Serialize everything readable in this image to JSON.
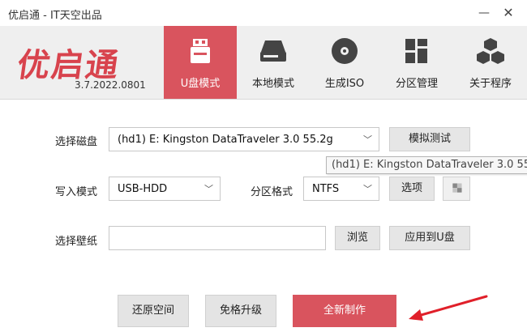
{
  "window": {
    "title": "优启通 - IT天空出品",
    "minimize_glyph": "—",
    "close_glyph": "✕"
  },
  "brand": {
    "logo_text": "优启通",
    "version": "3.7.2022.0801",
    "color": "#d8434d"
  },
  "nav": {
    "items": [
      {
        "label": "U盘模式",
        "icon": "usb-drive-icon",
        "active": true
      },
      {
        "label": "本地模式",
        "icon": "hard-disk-icon",
        "active": false
      },
      {
        "label": "生成ISO",
        "icon": "disc-icon",
        "active": false
      },
      {
        "label": "分区管理",
        "icon": "partition-grid-icon",
        "active": false
      },
      {
        "label": "关于程序",
        "icon": "about-cubes-icon",
        "active": false
      }
    ],
    "active_color": "#d9545e"
  },
  "form": {
    "disk_label": "选择磁盘",
    "disk_value": "(hd1) E: Kingston DataTraveler 3.0 55.2g",
    "simulate_button": "模拟测试",
    "tooltip": "(hd1) E: Kingston DataTraveler 3.0 55",
    "write_mode_label": "写入模式",
    "write_mode_value": "USB-HDD",
    "partition_format_label": "分区格式",
    "partition_format_value": "NTFS",
    "options_button": "选项",
    "wallpaper_label": "选择壁纸",
    "wallpaper_value": "",
    "browse_button": "浏览",
    "apply_button": "应用到U盘"
  },
  "actions": {
    "restore_button": "还原空间",
    "upgrade_button": "免格升级",
    "create_button": "全新制作"
  },
  "annotation": {
    "arrow_color": "#e0202a"
  }
}
